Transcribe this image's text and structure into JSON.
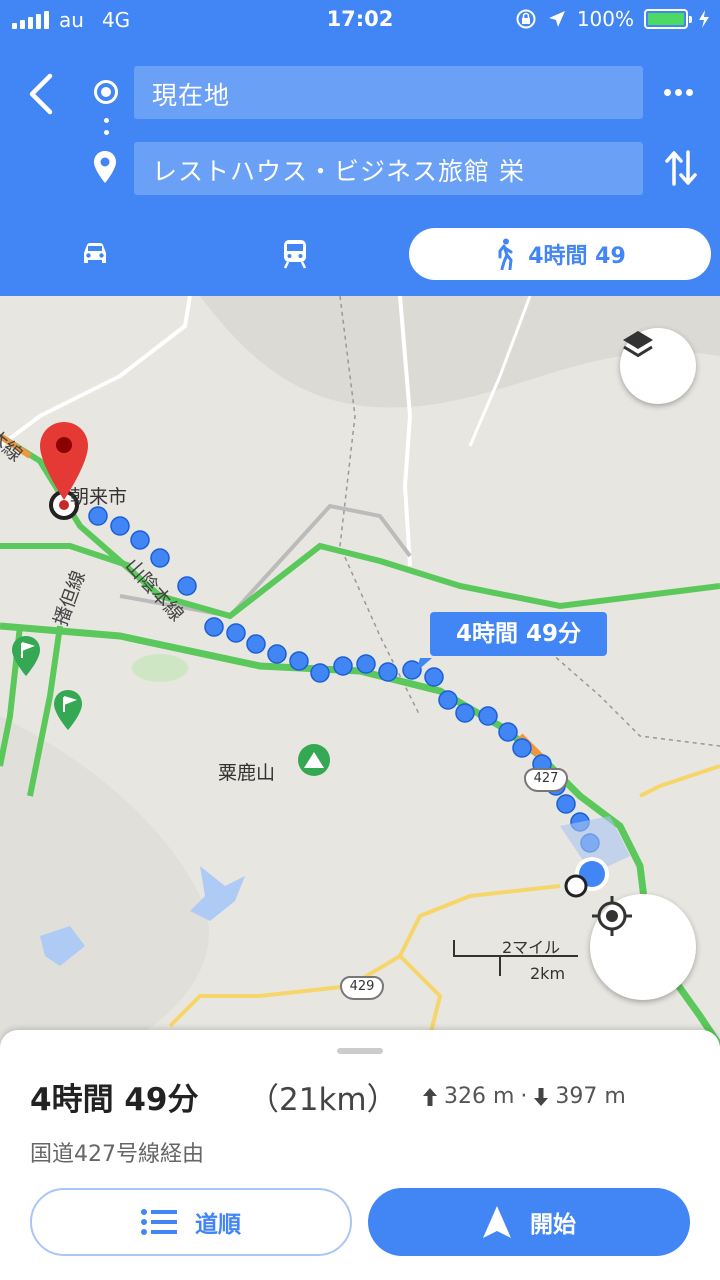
{
  "status_bar": {
    "carrier": "au",
    "network": "4G",
    "time": "17:02",
    "battery": "100%"
  },
  "header": {
    "origin": "現在地",
    "destination": "レストハウス・ビジネス旅館 栄",
    "walk_mode_duration": "4時間 49",
    "accent": "#4285f4"
  },
  "map": {
    "city_label": "朝来市",
    "mountain_label": "粟鹿山",
    "rail_label_1": "山陰本線",
    "rail_label_2": "播但線",
    "rail_label_3": "本線",
    "route_bubble": "4時間 49分",
    "route_shield_1": "427",
    "route_shield_2": "429",
    "scale_miles": "2マイル",
    "scale_km": "2km"
  },
  "summary": {
    "duration": "4時間 49分",
    "distance": "（21km）",
    "ascent": "326 m",
    "separator": "·",
    "descent": "397 m",
    "via": "国道427号線経由",
    "steps_label": "道順",
    "start_label": "開始"
  }
}
